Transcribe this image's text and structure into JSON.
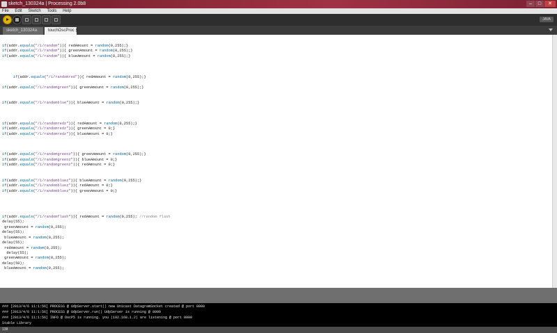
{
  "window": {
    "title": "sketch_130324a | Processing 2.0b8",
    "minimize": "–",
    "maximize": "□",
    "close": "✕"
  },
  "menu": [
    "File",
    "Edit",
    "Sketch",
    "Tools",
    "Help"
  ],
  "toolbar": {
    "mode": "JAVA"
  },
  "tabs": [
    "sketch_130324a",
    "touchOscProc §"
  ],
  "code": [
    [
      [
        "kw",
        "if"
      ],
      [
        "t",
        "(addr."
      ],
      [
        "kw",
        "equals"
      ],
      [
        "t",
        "("
      ],
      [
        "str",
        "\"/1/random\""
      ],
      [
        "t",
        ")){ redAmount = "
      ],
      [
        "kw",
        "random"
      ],
      [
        "t",
        "(0,255);}"
      ]
    ],
    [
      [
        "kw",
        "if"
      ],
      [
        "t",
        "(addr."
      ],
      [
        "kw",
        "equals"
      ],
      [
        "t",
        "("
      ],
      [
        "str",
        "\"/1/random\""
      ],
      [
        "t",
        ")){ greenAmount = "
      ],
      [
        "kw",
        "random"
      ],
      [
        "t",
        "(0,255);}"
      ]
    ],
    [
      [
        "kw",
        "if"
      ],
      [
        "t",
        "(addr."
      ],
      [
        "kw",
        "equals"
      ],
      [
        "t",
        "("
      ],
      [
        "str",
        "\"/1/random\""
      ],
      [
        "t",
        ")){ blueAmount = "
      ],
      [
        "kw",
        "random"
      ],
      [
        "t",
        "(0,255);}"
      ]
    ],
    [],
    [],
    [],
    [
      [
        "t",
        "     "
      ],
      [
        "kw",
        "if"
      ],
      [
        "t",
        "(addr."
      ],
      [
        "kw",
        "equals"
      ],
      [
        "t",
        "("
      ],
      [
        "str",
        "\"/1/randomred\""
      ],
      [
        "t",
        ")){ redAmount = "
      ],
      [
        "kw",
        "random"
      ],
      [
        "t",
        "(0,255);}"
      ]
    ],
    [],
    [
      [
        "kw",
        "if"
      ],
      [
        "t",
        "(addr."
      ],
      [
        "kw",
        "equals"
      ],
      [
        "t",
        "("
      ],
      [
        "str",
        "\"/1/randomgreen\""
      ],
      [
        "t",
        ")){ greenAmount = "
      ],
      [
        "kw",
        "random"
      ],
      [
        "t",
        "(0,255);}"
      ]
    ],
    [],
    [],
    [
      [
        "kw",
        "if"
      ],
      [
        "t",
        "(addr."
      ],
      [
        "kw",
        "equals"
      ],
      [
        "t",
        "("
      ],
      [
        "str",
        "\"/1/randomblue\""
      ],
      [
        "t",
        ")){ blueAmount = "
      ],
      [
        "kw",
        "random"
      ],
      [
        "t",
        "(0,255);}"
      ]
    ],
    [],
    [],
    [],
    [
      [
        "kw",
        "if"
      ],
      [
        "t",
        "(addr."
      ],
      [
        "kw",
        "equals"
      ],
      [
        "t",
        "("
      ],
      [
        "str",
        "\"/1/randomredz\""
      ],
      [
        "t",
        ")){ redAmount = "
      ],
      [
        "kw",
        "random"
      ],
      [
        "t",
        "(0,255);}"
      ]
    ],
    [
      [
        "kw",
        "if"
      ],
      [
        "t",
        "(addr."
      ],
      [
        "kw",
        "equals"
      ],
      [
        "t",
        "("
      ],
      [
        "str",
        "\"/1/randomredz\""
      ],
      [
        "t",
        ")){ greenAmount = 0;}"
      ]
    ],
    [
      [
        "kw",
        "if"
      ],
      [
        "t",
        "(addr."
      ],
      [
        "kw",
        "equals"
      ],
      [
        "t",
        "("
      ],
      [
        "str",
        "\"/1/randomredz\""
      ],
      [
        "t",
        ")){ blueAmount = 0;}"
      ]
    ],
    [],
    [],
    [],
    [
      [
        "kw",
        "if"
      ],
      [
        "t",
        "(addr."
      ],
      [
        "kw",
        "equals"
      ],
      [
        "t",
        "("
      ],
      [
        "str",
        "\"/1/randomgreenz\""
      ],
      [
        "t",
        ")){ greenAmount = "
      ],
      [
        "kw",
        "random"
      ],
      [
        "t",
        "(0,255);}"
      ]
    ],
    [
      [
        "kw",
        "if"
      ],
      [
        "t",
        "(addr."
      ],
      [
        "kw",
        "equals"
      ],
      [
        "t",
        "("
      ],
      [
        "str",
        "\"/1/randomgreenz\""
      ],
      [
        "t",
        ")){ blueAmount = 0;}"
      ]
    ],
    [
      [
        "kw",
        "if"
      ],
      [
        "t",
        "(addr."
      ],
      [
        "kw",
        "equals"
      ],
      [
        "t",
        "("
      ],
      [
        "str",
        "\"/1/randomgreenz\""
      ],
      [
        "t",
        ")){ redAmount = 0;}"
      ]
    ],
    [],
    [],
    [
      [
        "kw",
        "if"
      ],
      [
        "t",
        "(addr."
      ],
      [
        "kw",
        "equals"
      ],
      [
        "t",
        "("
      ],
      [
        "str",
        "\"/1/randombluez\""
      ],
      [
        "t",
        ")){ blueAmount = "
      ],
      [
        "kw",
        "random"
      ],
      [
        "t",
        "(0,255);}"
      ]
    ],
    [
      [
        "kw",
        "if"
      ],
      [
        "t",
        "(addr."
      ],
      [
        "kw",
        "equals"
      ],
      [
        "t",
        "("
      ],
      [
        "str",
        "\"/1/randombluez\""
      ],
      [
        "t",
        ")){ redAmount = 0;}"
      ]
    ],
    [
      [
        "kw",
        "if"
      ],
      [
        "t",
        "(addr."
      ],
      [
        "kw",
        "equals"
      ],
      [
        "t",
        "("
      ],
      [
        "str",
        "\"/1/randombluez\""
      ],
      [
        "t",
        ")){ greenAmount = 0;}"
      ]
    ],
    [],
    [],
    [],
    [],
    [
      [
        "kw",
        "if"
      ],
      [
        "t",
        "(addr."
      ],
      [
        "kw",
        "equals"
      ],
      [
        "t",
        "("
      ],
      [
        "str",
        "\"/1/randomflash\""
      ],
      [
        "t",
        ")){ redAmount = "
      ],
      [
        "kw",
        "random"
      ],
      [
        "t",
        "(0,255); "
      ],
      [
        "cm",
        "//random flash"
      ]
    ],
    [
      [
        "t",
        "delay(55);"
      ]
    ],
    [
      [
        "t",
        " greenAmount = "
      ],
      [
        "kw",
        "random"
      ],
      [
        "t",
        "(0,255);"
      ]
    ],
    [
      [
        "t",
        "delay(55);"
      ]
    ],
    [
      [
        "t",
        " blueAmount = "
      ],
      [
        "kw",
        "random"
      ],
      [
        "t",
        "(0,255);"
      ]
    ],
    [
      [
        "t",
        "delay(55);"
      ]
    ],
    [
      [
        "t",
        " redAmount = "
      ],
      [
        "kw",
        "random"
      ],
      [
        "t",
        "(0,255);"
      ]
    ],
    [
      [
        "t",
        "  delay(55);"
      ]
    ],
    [
      [
        "t",
        " greenAmount = "
      ],
      [
        "kw",
        "random"
      ],
      [
        "t",
        "(0,255);"
      ]
    ],
    [
      [
        "t",
        "delay(50);"
      ]
    ],
    [
      [
        "t",
        " blueAmount = "
      ],
      [
        "kw",
        "random"
      ],
      [
        "t",
        "(0,255);"
      ]
    ]
  ],
  "console": [
    "### [2013/4/6 11:1:56] PROCESS @ UdpServer.start() new Unicast DatagramSocket created @ port 8000",
    "### [2013/4/6 11:1:56] PROCESS @ UdpServer.run() UdpServer is running @ 8000",
    "### [2013/4/6 11:1:56] INFO @ OscP5 is running. you (192.168.1.2) are listening @ port 8000",
    "Stable Library"
  ],
  "footer": {
    "line_number": "138"
  },
  "colors": {
    "keyword": "#006699",
    "string": "#7d4793",
    "comment": "#888888",
    "run_button": "#e3b100"
  }
}
